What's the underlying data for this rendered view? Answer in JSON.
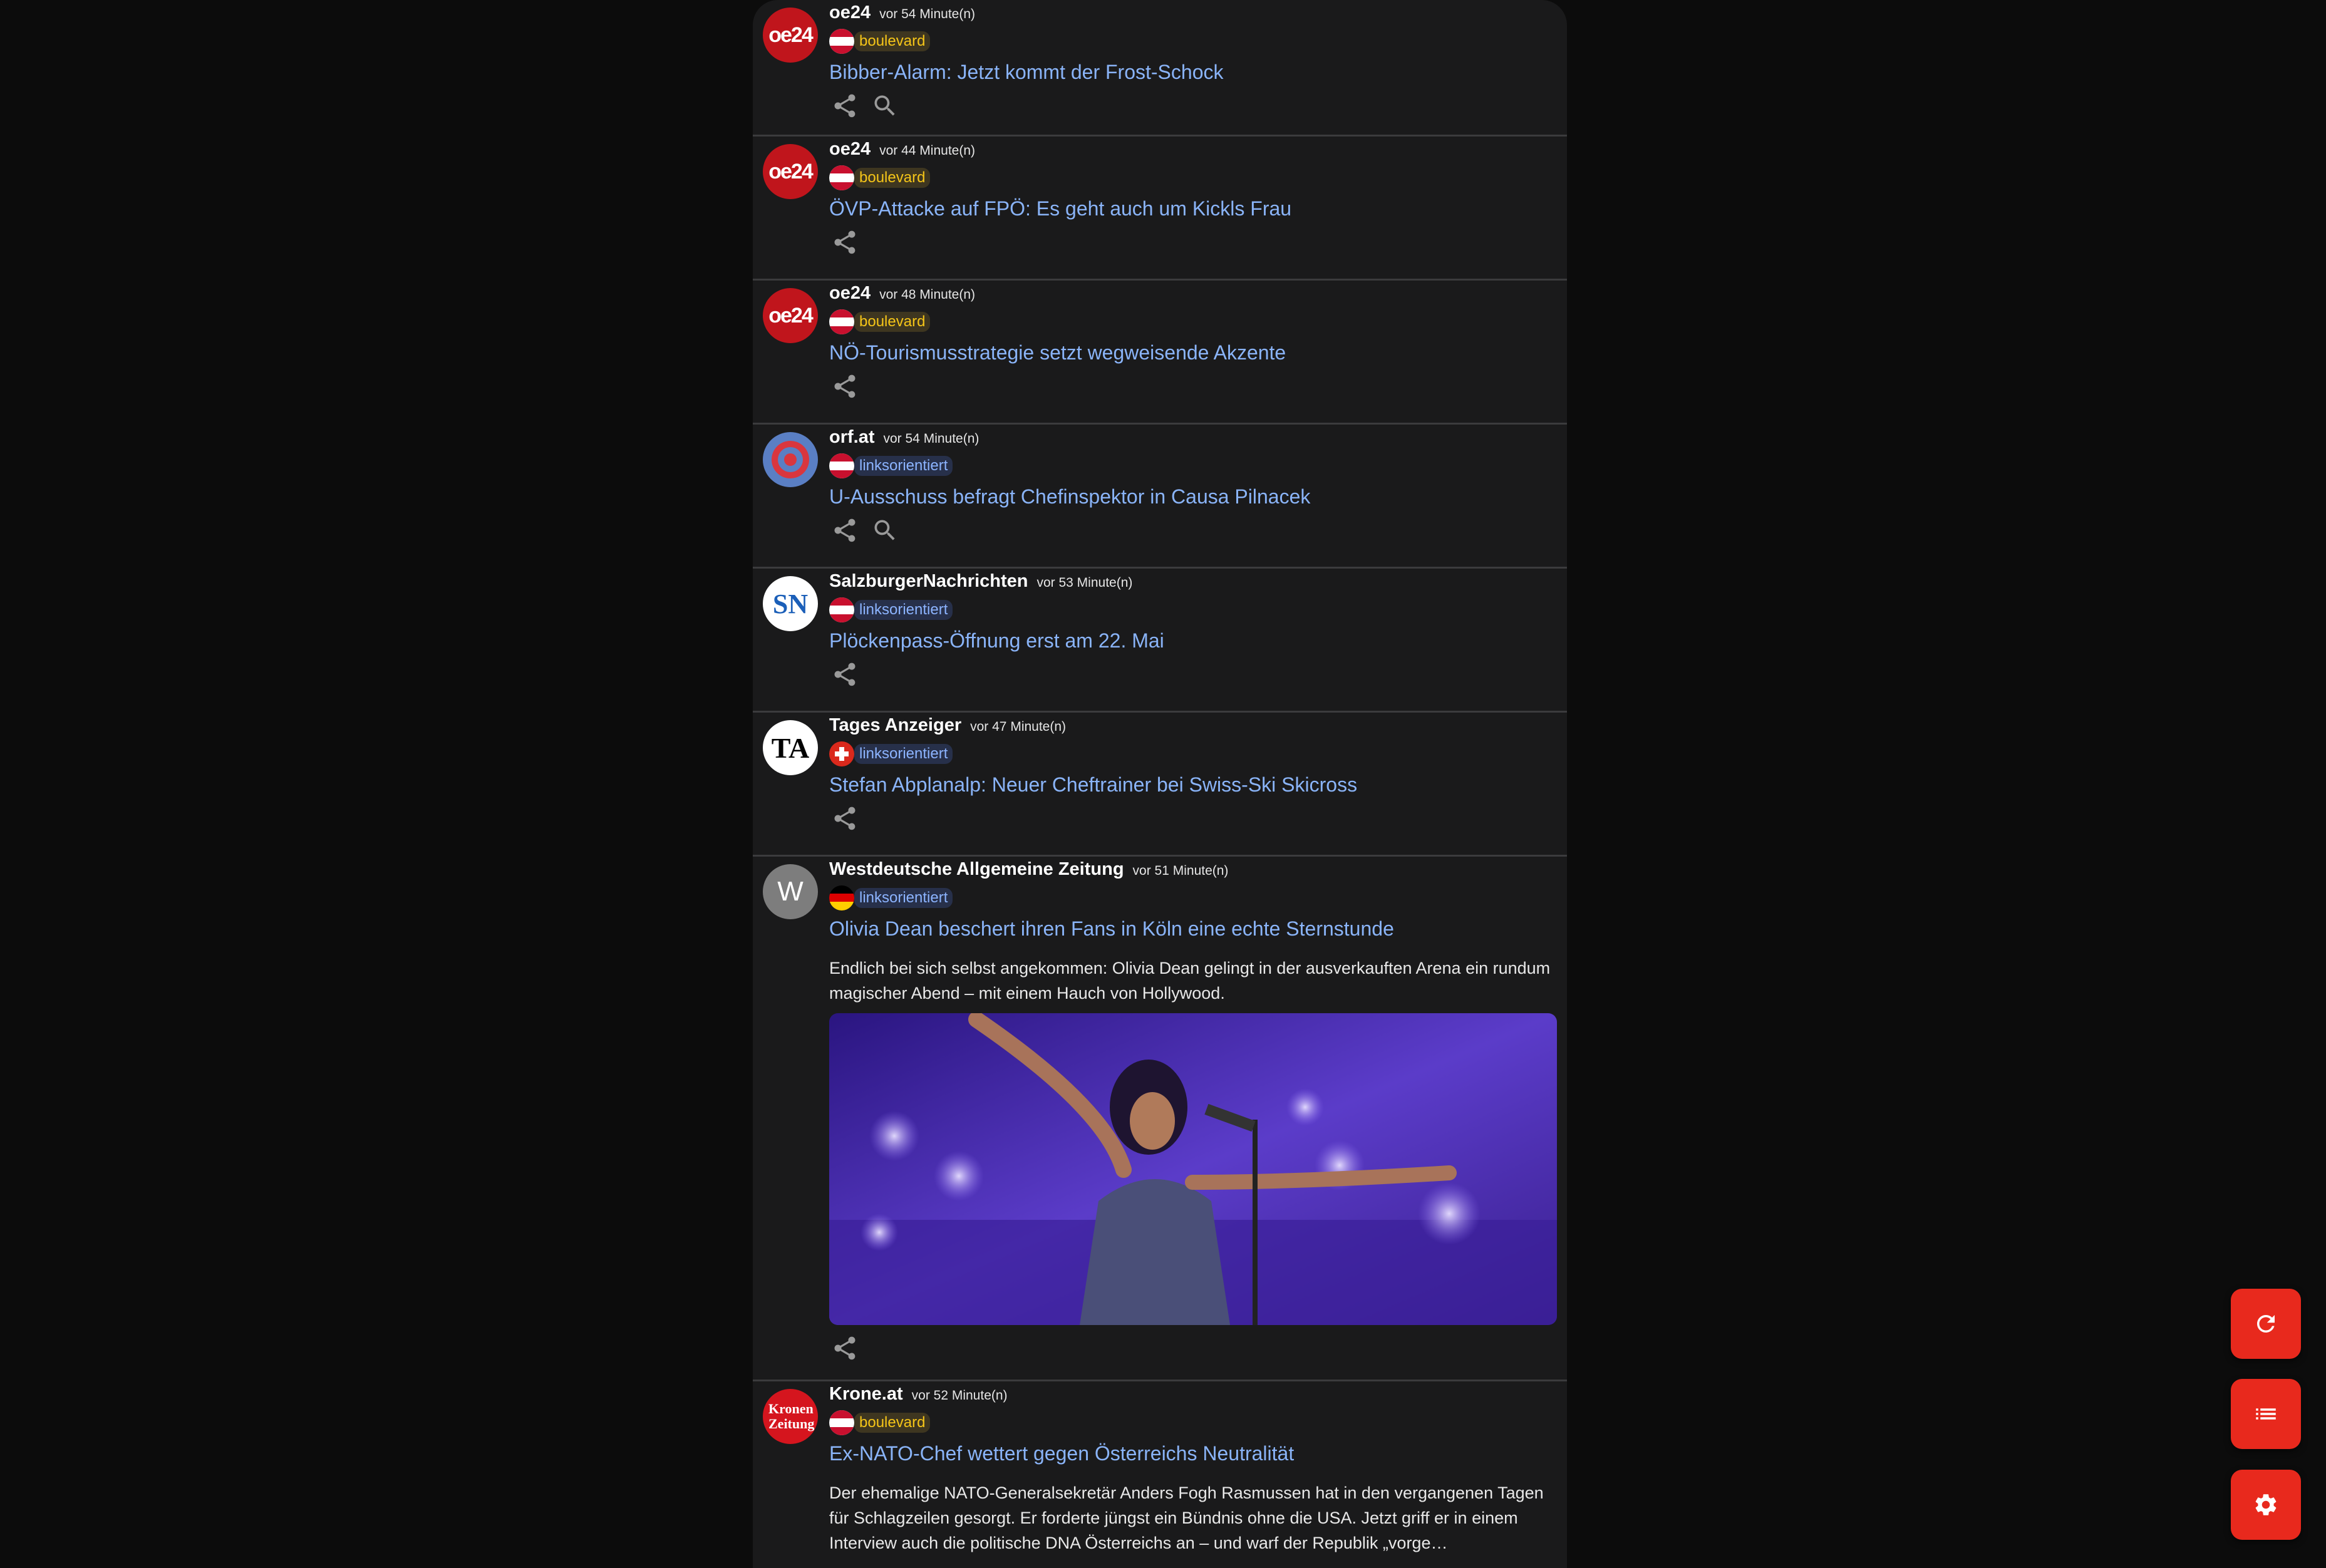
{
  "feed": {
    "items": [
      {
        "source": "oe24",
        "time": "vor 54 Minute(n)",
        "flag": "at",
        "category": "boulevard",
        "headline": "Bibber-Alarm: Jetzt kommt der Frost-Schock",
        "logo": "oe24",
        "actions": [
          "share",
          "search"
        ]
      },
      {
        "source": "oe24",
        "time": "vor 44 Minute(n)",
        "flag": "at",
        "category": "boulevard",
        "headline": "ÖVP-Attacke auf FPÖ: Es geht auch um Kickls Frau",
        "logo": "oe24",
        "actions": [
          "share"
        ]
      },
      {
        "source": "oe24",
        "time": "vor 48 Minute(n)",
        "flag": "at",
        "category": "boulevard",
        "headline": "NÖ-Tourismusstrategie setzt wegweisende Akzente",
        "logo": "oe24",
        "actions": [
          "share"
        ]
      },
      {
        "source": "orf.at",
        "time": "vor 54 Minute(n)",
        "flag": "at",
        "category": "linksorientiert",
        "headline": "U-Ausschuss befragt Chefinspektor in Causa Pilnacek",
        "logo": "orf",
        "actions": [
          "share",
          "search"
        ]
      },
      {
        "source": "SalzburgerNachrichten",
        "time": "vor 53 Minute(n)",
        "flag": "at",
        "category": "linksorientiert",
        "headline": "Plöckenpass-Öffnung erst am 22. Mai",
        "logo": "SN",
        "actions": [
          "share"
        ]
      },
      {
        "source": "Tages Anzeiger",
        "time": "vor 47 Minute(n)",
        "flag": "ch",
        "category": "linksorientiert",
        "headline": "Stefan Abplanalp: Neuer Cheftrainer bei Swiss-Ski Skicross",
        "logo": "TA",
        "actions": [
          "share"
        ]
      },
      {
        "source": "Westdeutsche Allgemeine Zeitung",
        "time": "vor 51 Minute(n)",
        "flag": "de",
        "category": "linksorientiert",
        "headline": "Olivia Dean beschert ihren Fans in Köln eine echte Sternstunde",
        "logo": "W",
        "description": "Endlich bei sich selbst angekommen: Olivia Dean gelingt in der ausverkauften Arena ein rundum magischer Abend – mit einem Hauch von Hollywood.",
        "image": "concert-photo",
        "actions": [
          "share"
        ]
      },
      {
        "source": "Krone.at",
        "time": "vor 52 Minute(n)",
        "flag": "at",
        "category": "boulevard",
        "headline": "Ex-NATO-Chef wettert gegen Österreichs Neutralität",
        "logo": "Kronen Zeitung",
        "description": "Der ehemalige NATO-Generalsekretär Anders Fogh Rasmussen hat in den vergangenen Tagen für Schlagzeilen gesorgt. Er forderte jüngst ein Bündnis ohne die USA. Jetzt griff er in einem Interview auch die politische DNA Österreichs an – und warf der Republik „vorge…",
        "actions": []
      }
    ]
  },
  "fabs": [
    {
      "name": "refresh",
      "icon": "refresh-icon"
    },
    {
      "name": "list",
      "icon": "list-icon"
    },
    {
      "name": "settings",
      "icon": "gear-icon"
    }
  ],
  "colors": {
    "background": "#0c0c0c",
    "card": "#1a1a1b",
    "headline": "#8ab4f8",
    "boulevard": "#f5c518",
    "linksorientiert": "#8cb4ff",
    "fab": "#e8291d"
  }
}
